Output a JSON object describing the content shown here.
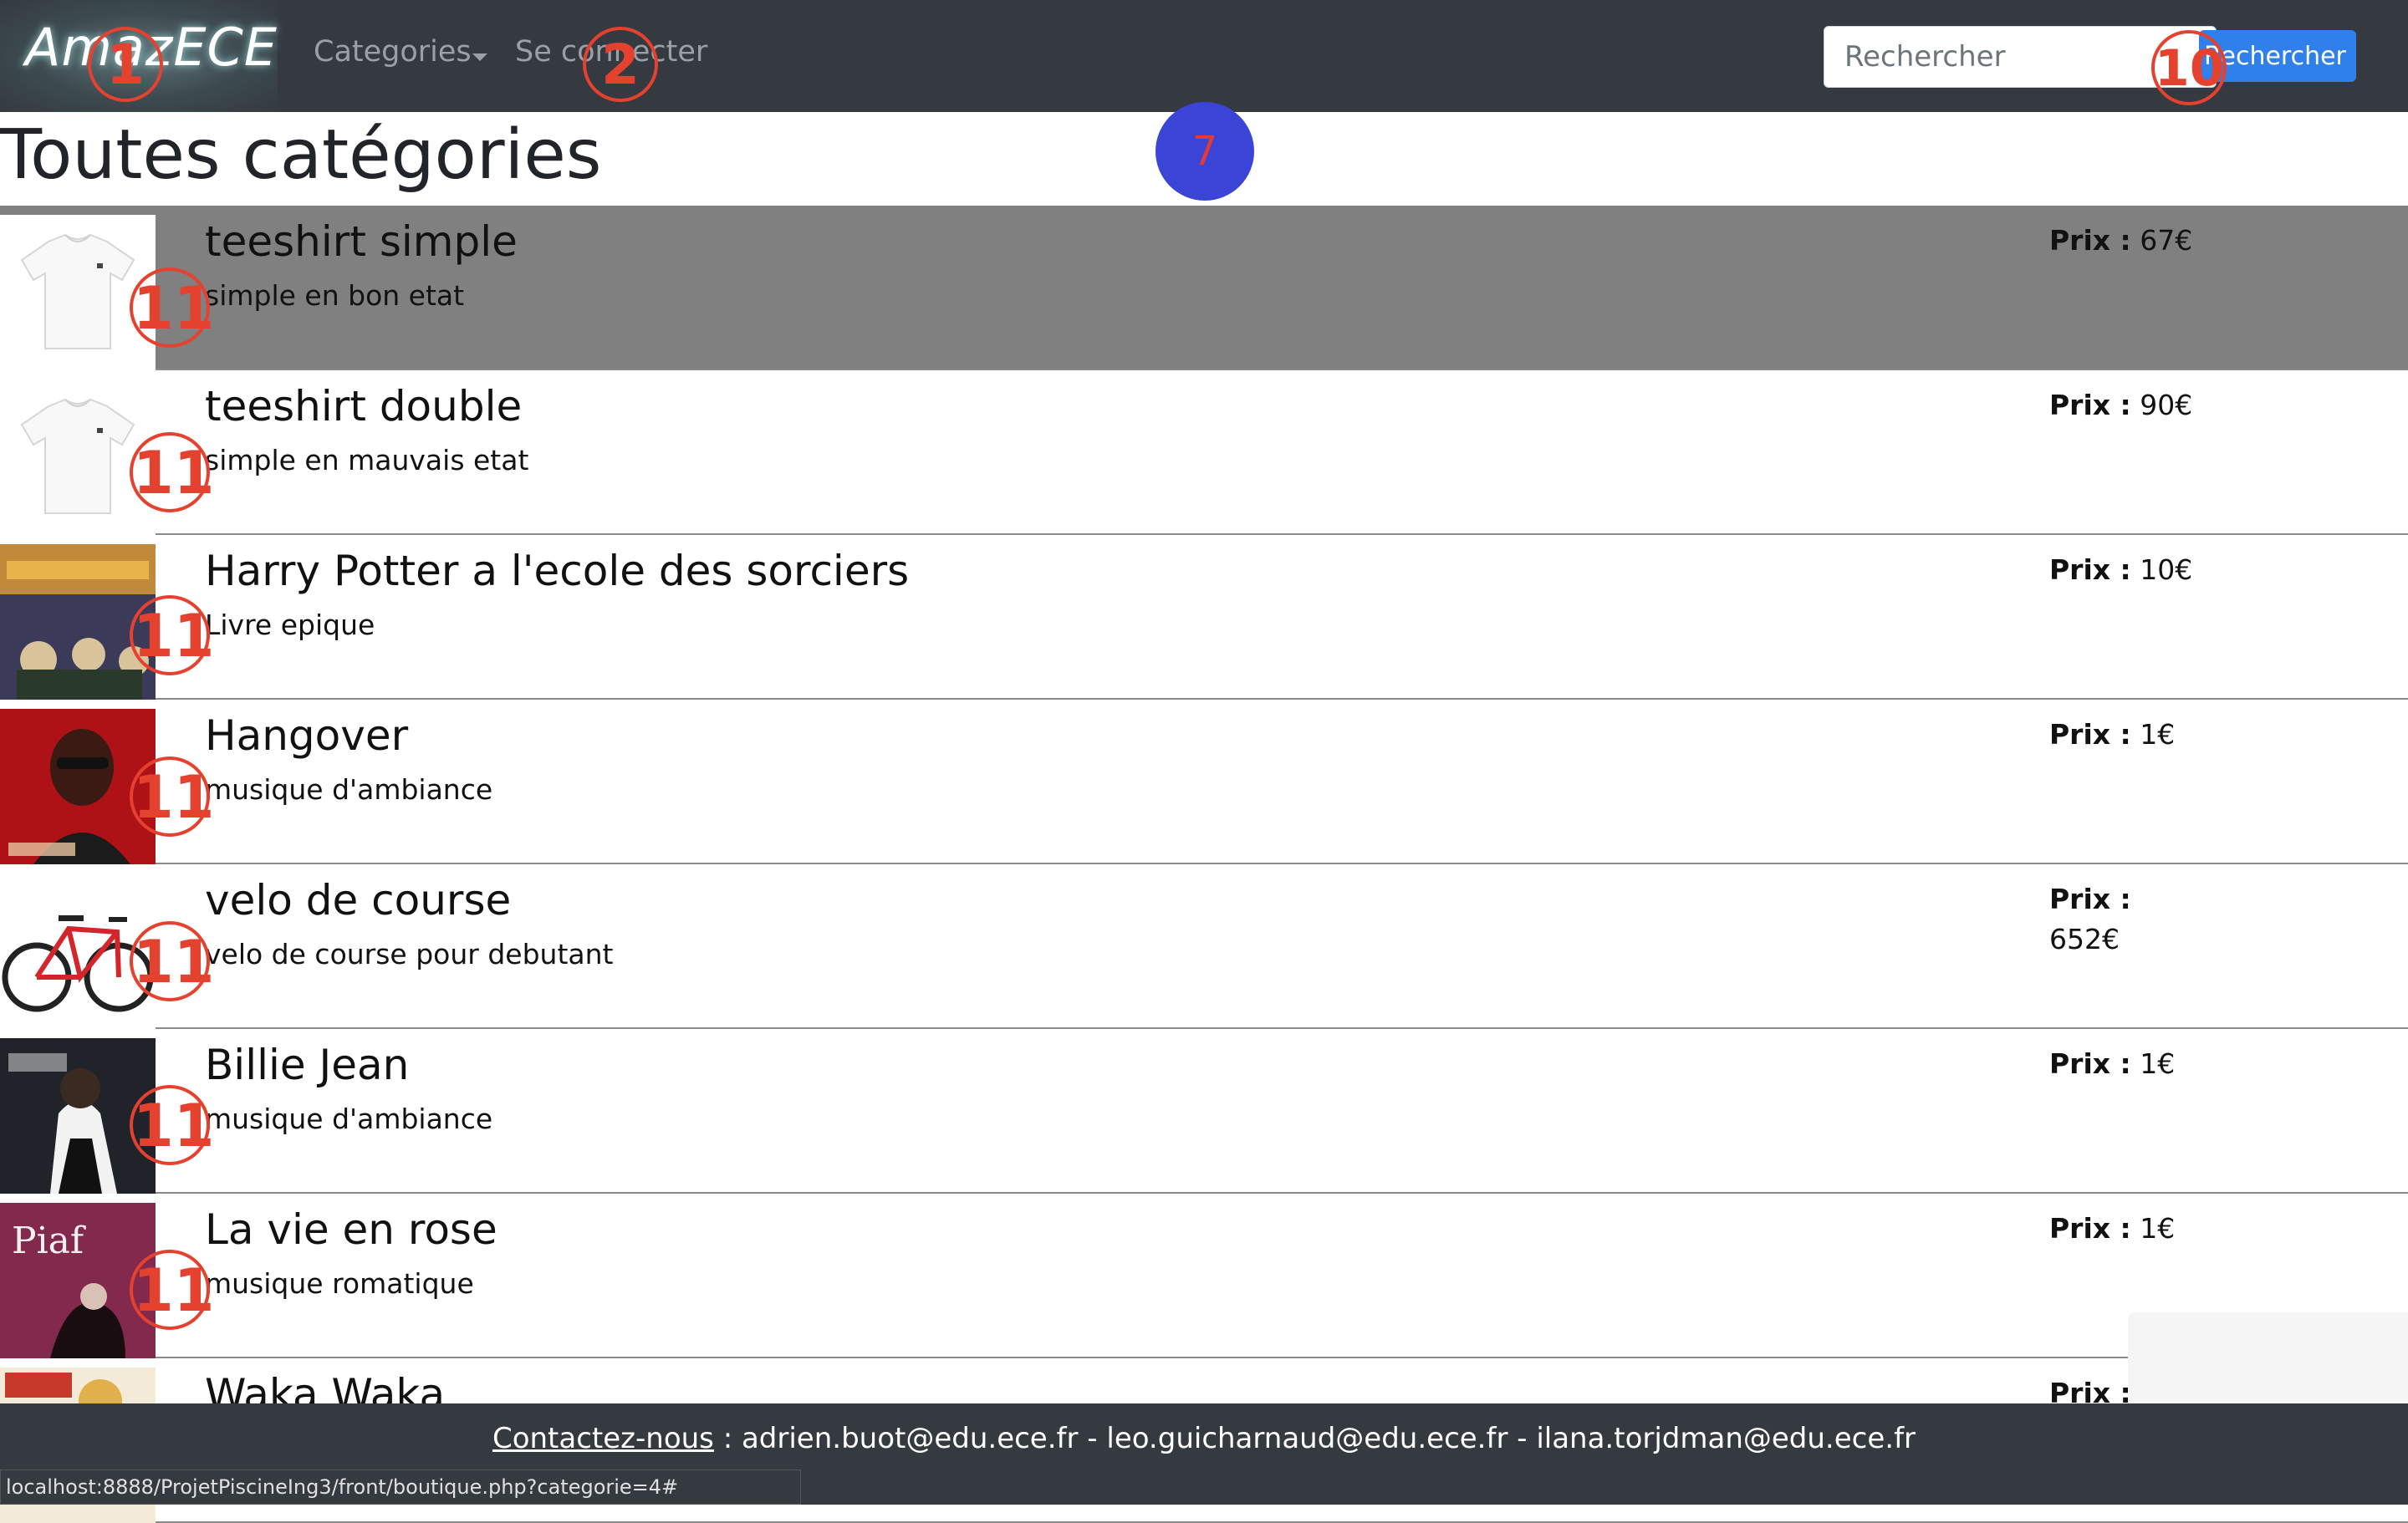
{
  "navbar": {
    "brand": "AmazECE",
    "categories_label": "Categories",
    "login_label": "Se connecter",
    "search_placeholder": "Rechercher",
    "search_button": "Rechercher"
  },
  "markers": {
    "brand": "1",
    "login": "2",
    "search": "10",
    "title": "7",
    "item": "11"
  },
  "page": {
    "title": "Toutes catégories"
  },
  "products": [
    {
      "name": "teeshirt simple",
      "description": "simple en bon etat",
      "price_label": "Prix :",
      "price": "67€",
      "image": "white-tshirt"
    },
    {
      "name": "teeshirt double",
      "description": "simple en mauvais etat",
      "price_label": "Prix :",
      "price": "90€",
      "image": "white-tshirt"
    },
    {
      "name": "Harry Potter a l'ecole des sorciers",
      "description": "Livre epique",
      "price_label": "Prix :",
      "price": "10€",
      "image": "harry-potter-book-cover"
    },
    {
      "name": "Hangover",
      "description": "musique d'ambiance",
      "price_label": "Prix :",
      "price": "1€",
      "image": "hangover-album-cover"
    },
    {
      "name": "velo de course",
      "description": "velo de course pour debutant",
      "price_label": "Prix :",
      "price": "652€",
      "image": "red-bicycle"
    },
    {
      "name": "Billie Jean",
      "description": "musique d'ambiance",
      "price_label": "Prix :",
      "price": "1€",
      "image": "billie-jean-album-cover"
    },
    {
      "name": "La vie en rose",
      "description": "musique romatique",
      "price_label": "Prix :",
      "price": "1€",
      "image": "piaf-album-cover"
    },
    {
      "name": "Waka Waka",
      "description": "",
      "price_label": "Prix :",
      "price": "",
      "image": "waka-waka-cover"
    }
  ],
  "footer": {
    "contact_label": "Contactez-nous",
    "contacts": " : adrien.buot@edu.ece.fr - leo.guicharnaud@edu.ece.fr - ilana.torjdman@edu.ece.fr"
  },
  "status_bar": {
    "url": "localhost:8888/ProjetPiscineIng3/front/boutique.php?categorie=4#"
  },
  "colors": {
    "navbar": "#343a40",
    "primary_button": "#2f80ed",
    "selected_row": "#808080",
    "marker": "#e5412f",
    "marker_blue": "#3a44d6"
  }
}
